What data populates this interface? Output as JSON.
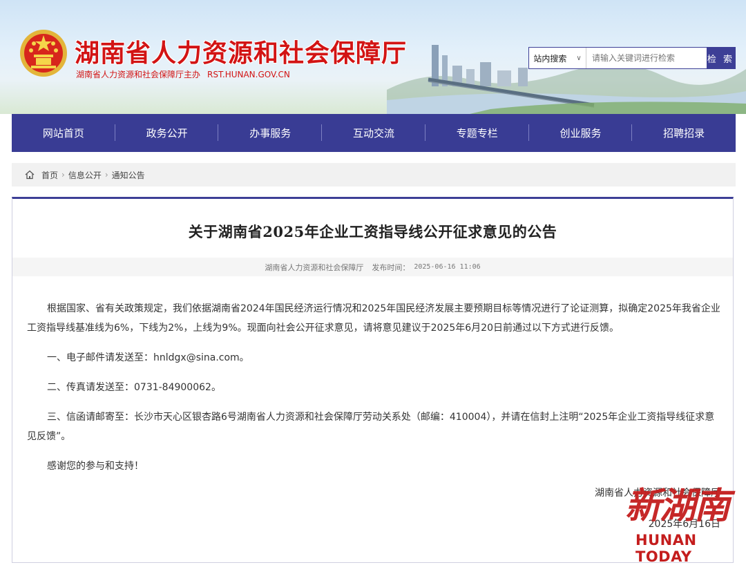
{
  "header": {
    "site_title": "湖南省人力资源和社会保障厅",
    "sponsor": "湖南省人力资源和社会保障厅主办",
    "domain": "RST.HUNAN.GOV.CN"
  },
  "search": {
    "scope_label": "站内搜索",
    "placeholder": "请输入关键词进行检索",
    "button_label": "检 索"
  },
  "nav": {
    "items": [
      "网站首页",
      "政务公开",
      "办事服务",
      "互动交流",
      "专题专栏",
      "创业服务",
      "招聘招录"
    ]
  },
  "breadcrumb": {
    "items": [
      "首页",
      "信息公开",
      "通知公告"
    ]
  },
  "article": {
    "title": "关于湖南省2025年企业工资指导线公开征求意见的公告",
    "source": "湖南省人力资源和社会保障厅",
    "publish_label": "发布时间：",
    "publish_time": "2025-06-16 11:06",
    "paragraphs": [
      "根据国家、省有关政策规定，我们依据湖南省2024年国民经济运行情况和2025年国民经济发展主要预期目标等情况进行了论证测算，拟确定2025年我省企业工资指导线基准线为6%，下线为2%，上线为9%。现面向社会公开征求意见，请将意见建议于2025年6月20日前通过以下方式进行反馈。",
      "一、电子邮件请发送至：hnldgx@sina.com。",
      "二、传真请发送至：0731-84900062。",
      "三、信函请邮寄至：长沙市天心区银杏路6号湖南省人力资源和社会保障厅劳动关系处（邮编：410004），并请在信封上注明“2025年企业工资指导线征求意见反馈”。",
      "感谢您的参与和支持！"
    ],
    "signature_org": "湖南省人力资源和社会保障厅",
    "signature_date": "2025年6月16日"
  },
  "watermark": {
    "cn": "新湖南",
    "en": "HUNAN TODAY"
  },
  "colors": {
    "brand_red": "#d21414",
    "nav_blue": "#393c94"
  }
}
